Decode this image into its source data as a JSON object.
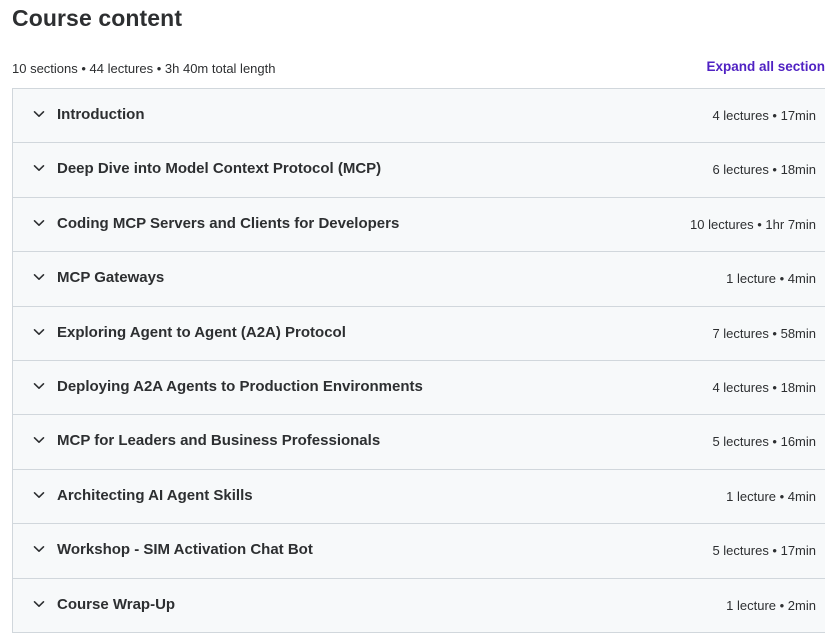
{
  "header": {
    "title": "Course content",
    "summary": "10 sections • 44 lectures • 3h 40m total length",
    "expand_all_label": "Expand all section"
  },
  "colors": {
    "accent": "#5022c3",
    "section_bg": "#f7f9fa",
    "border": "#d1d7dc",
    "text": "#2d2f31"
  },
  "sections": [
    {
      "title": "Introduction",
      "meta": "4 lectures • 17min"
    },
    {
      "title": "Deep Dive into Model Context Protocol (MCP)",
      "meta": "6 lectures • 18min"
    },
    {
      "title": "Coding MCP Servers and Clients for Developers",
      "meta": "10 lectures • 1hr 7min"
    },
    {
      "title": "MCP Gateways",
      "meta": "1 lecture • 4min"
    },
    {
      "title": "Exploring Agent to Agent (A2A) Protocol",
      "meta": "7 lectures • 58min"
    },
    {
      "title": "Deploying A2A Agents to Production Environments",
      "meta": "4 lectures • 18min"
    },
    {
      "title": "MCP for Leaders and Business Professionals",
      "meta": "5 lectures • 16min"
    },
    {
      "title": "Architecting AI Agent Skills",
      "meta": "1 lecture • 4min"
    },
    {
      "title": "Workshop - SIM Activation Chat Bot",
      "meta": "5 lectures • 17min"
    },
    {
      "title": "Course Wrap-Up",
      "meta": "1 lecture • 2min"
    }
  ],
  "icons": {
    "section_toggle": "chevron-down-icon"
  }
}
